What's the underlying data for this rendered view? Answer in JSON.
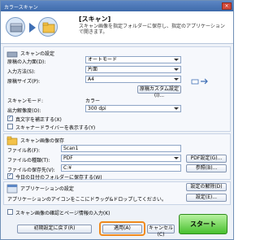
{
  "window": {
    "title": "カラースキャン",
    "close_label": "×"
  },
  "header": {
    "title": "[スキャン]",
    "description": "スキャン画像を指定フォルダーに保存し、指定のアプリケーションで開きます。"
  },
  "scan_settings": {
    "section_title": "スキャンの設定",
    "input_method_label": "原稿の入力面(D):",
    "input_method_value": "オートモード",
    "input_side_label": "入力方法(S):",
    "input_side_value": "片面",
    "paper_size_label": "原稿サイズ(P):",
    "paper_size_value": "A4",
    "custom_size_button": "原稿カスタム設定(I)...",
    "scan_mode_label": "スキャンモード:",
    "scan_mode_value": "カラー",
    "resolution_label": "出力解像度(O):",
    "resolution_value": "300 dpi",
    "deskew_label": "真文字を補正する(X)",
    "show_driver_label": "スキャナードライバーを表示する(Y)"
  },
  "save_settings": {
    "section_title": "スキャン画像の保存",
    "filename_label": "ファイル名(F):",
    "filename_value": "Scan1",
    "filetype_label": "ファイルの種類(T):",
    "filetype_value": "PDF",
    "pdf_settings_button": "PDF設定(G)...",
    "save_location_label": "ファイルの保存先(V):",
    "save_location_value": "C:¥",
    "browse_button": "参照(B)...",
    "date_subfolder_label": "今日の日付のフォルダーに保存する(W)"
  },
  "app_settings": {
    "section_title": "アプリケーションの設定",
    "instruction": "アプリケーションのアイコンをここにドラッグ&ドロップしてください。",
    "release_button": "設定の解除(D)",
    "settings_button": "設定(E)..."
  },
  "footer": {
    "confirm_checkbox_label": "スキャン画像の確認とページ情報の入力(K)",
    "reset_button": "初期設定に戻す(R)",
    "apply_button": "適用(A)",
    "cancel_button": "キャンセル(C)",
    "start_button": "スタート"
  }
}
